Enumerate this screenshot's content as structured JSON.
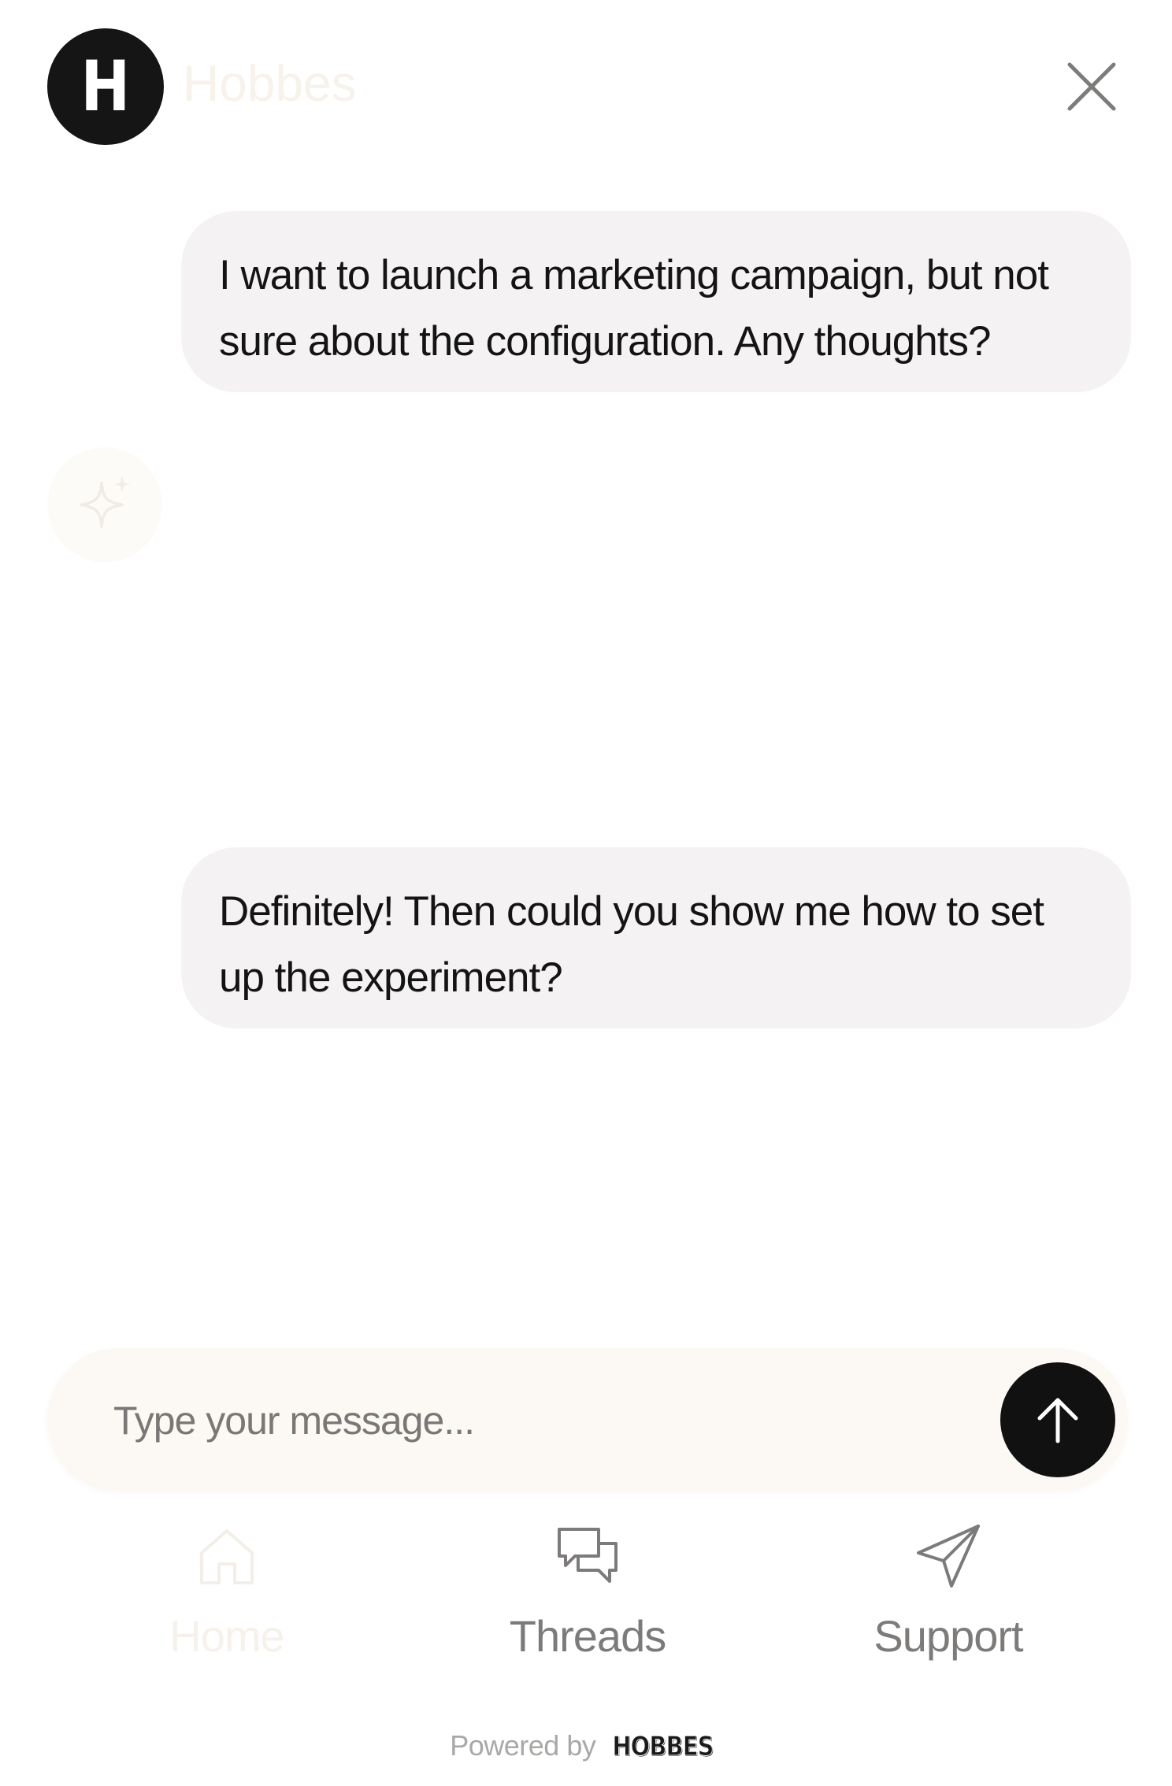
{
  "header": {
    "logo_letter": "H",
    "brand_name": "Hobbes"
  },
  "messages": [
    {
      "role": "user",
      "text": "I want to launch a marketing campaign, but not sure about the configuration. Any thoughts?"
    },
    {
      "role": "user",
      "text": "Definitely! Then could you show me how to set up the experiment?"
    }
  ],
  "composer": {
    "placeholder": "Type your message..."
  },
  "nav": {
    "items": [
      {
        "label": "Home",
        "icon": "home-icon",
        "active": false
      },
      {
        "label": "Threads",
        "icon": "threads-icon",
        "active": true
      },
      {
        "label": "Support",
        "icon": "send-icon",
        "active": true
      }
    ]
  },
  "footer": {
    "powered_by": "Powered by",
    "brand": "HOBBES"
  },
  "colors": {
    "accent": "#111111",
    "bubble": "#f4f2f3",
    "composer_bg": "#fcf8f3",
    "muted_text": "#7d7b7a"
  }
}
